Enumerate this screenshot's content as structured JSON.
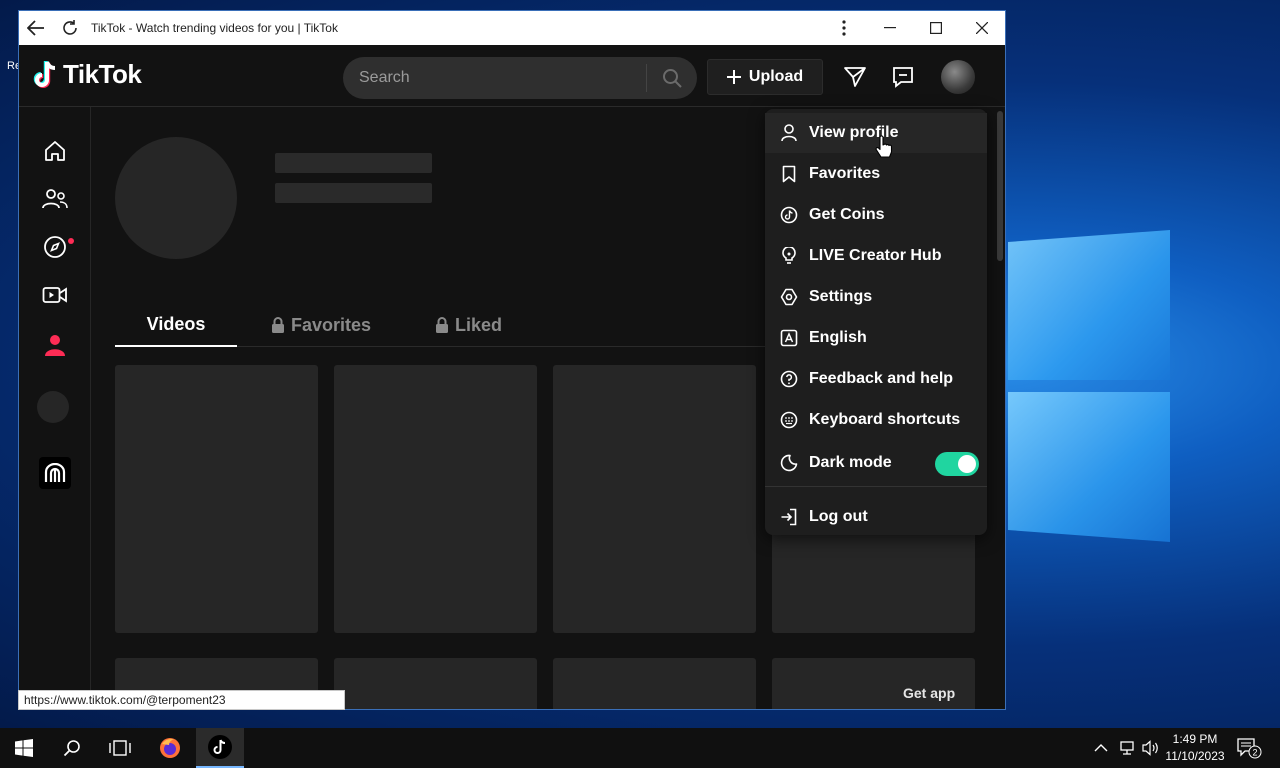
{
  "browser": {
    "title": "TikTok - Watch trending videos for you | TikTok",
    "status_url": "https://www.tiktok.com/@terpoment23"
  },
  "header": {
    "logo_text": "TikTok",
    "search_placeholder": "Search",
    "upload_label": "Upload"
  },
  "sidebar": {
    "items": [
      "home-icon",
      "following-icon",
      "explore-icon",
      "live-icon",
      "profile-icon",
      "avatar",
      "creator-icon"
    ],
    "notification_color": "#fe2c55"
  },
  "profile": {
    "tabs": [
      {
        "label": "Videos",
        "active": true,
        "locked": false
      },
      {
        "label": "Favorites",
        "active": false,
        "locked": true
      },
      {
        "label": "Liked",
        "active": false,
        "locked": true
      }
    ],
    "get_app_label": "Get app"
  },
  "menu": {
    "items": [
      {
        "label": "View profile",
        "icon": "person-icon"
      },
      {
        "label": "Favorites",
        "icon": "bookmark-icon"
      },
      {
        "label": "Get Coins",
        "icon": "tiktok-coin-icon"
      },
      {
        "label": "LIVE Creator Hub",
        "icon": "lightbulb-icon"
      },
      {
        "label": "Settings",
        "icon": "gear-icon"
      },
      {
        "label": "English",
        "icon": "language-icon"
      },
      {
        "label": "Feedback and help",
        "icon": "help-icon"
      },
      {
        "label": "Keyboard shortcuts",
        "icon": "keyboard-icon"
      },
      {
        "label": "Dark mode",
        "icon": "moon-icon",
        "toggle_on": true
      },
      {
        "label": "Log out",
        "icon": "logout-icon"
      }
    ],
    "toggle_color": "#20d5a0"
  },
  "taskbar": {
    "time": "1:49 PM",
    "date": "11/10/2023",
    "notification_count": "2"
  },
  "desktop": {
    "label": "Re"
  }
}
